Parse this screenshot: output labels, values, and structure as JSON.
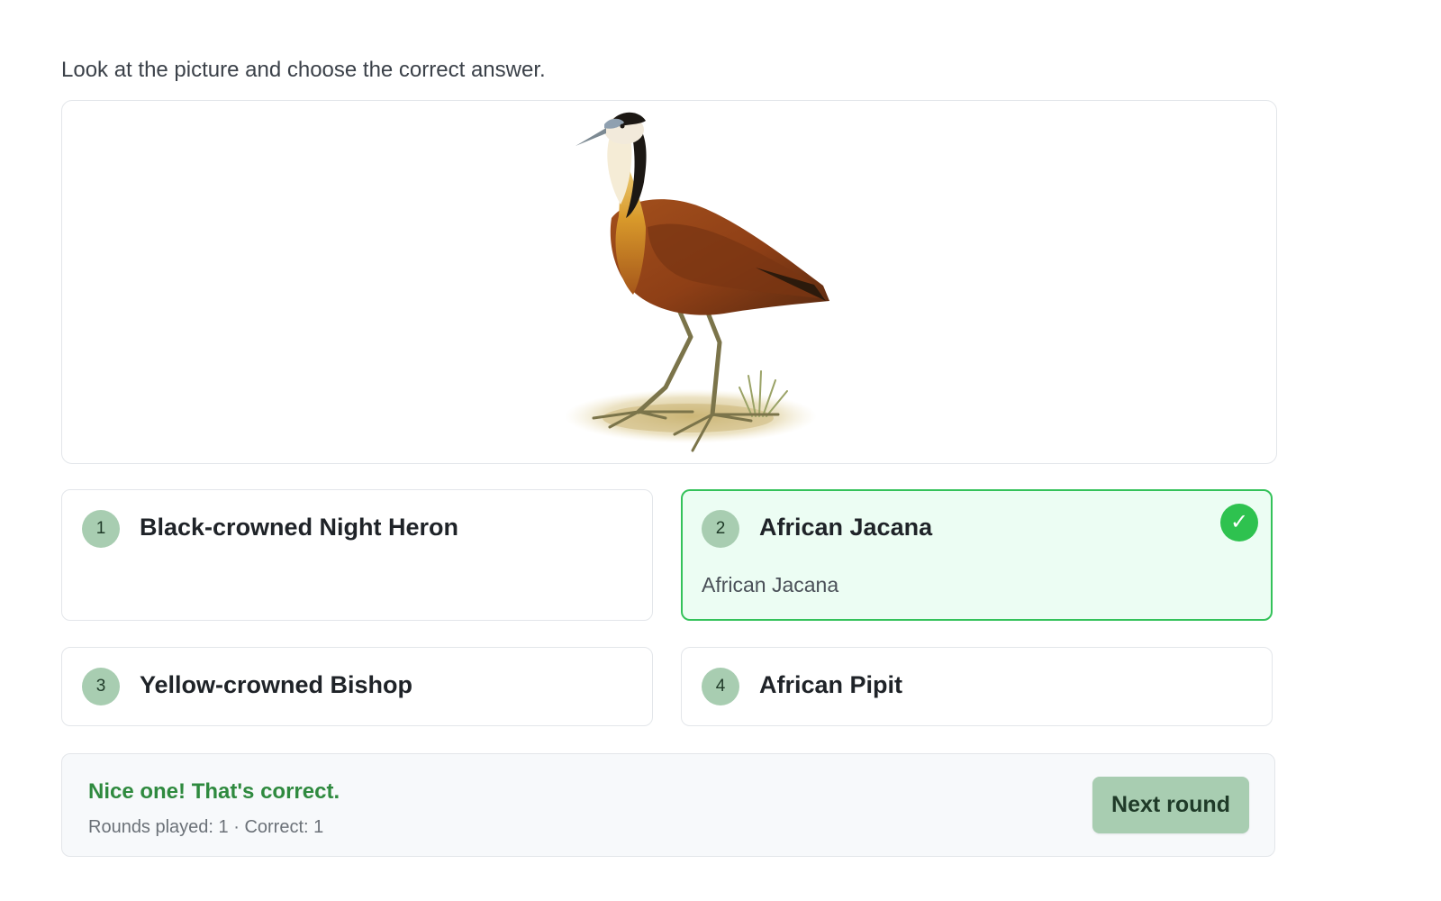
{
  "prompt": "Look at the picture and choose the correct answer.",
  "picture": {
    "icon": "african-jacana-illustration"
  },
  "options": [
    {
      "number": "1",
      "label": "Black-crowned Night Heron",
      "state": "neutral"
    },
    {
      "number": "2",
      "label": "African Jacana",
      "state": "correct",
      "reveal": "African Jacana",
      "icon": "check-icon",
      "glyph": "✓"
    },
    {
      "number": "3",
      "label": "Yellow-crowned Bishop",
      "state": "neutral"
    },
    {
      "number": "4",
      "label": "African Pipit",
      "state": "neutral"
    }
  ],
  "feedback": {
    "message": "Nice one! That's correct.",
    "stats": "Rounds played: 1 · Correct: 1",
    "next_label": "Next round"
  },
  "colors": {
    "correct_accent": "#2ec24f",
    "correct_background": "#ecfdf3",
    "badge_background": "#a8cdb1",
    "feedback_text": "#2f8a3f"
  }
}
